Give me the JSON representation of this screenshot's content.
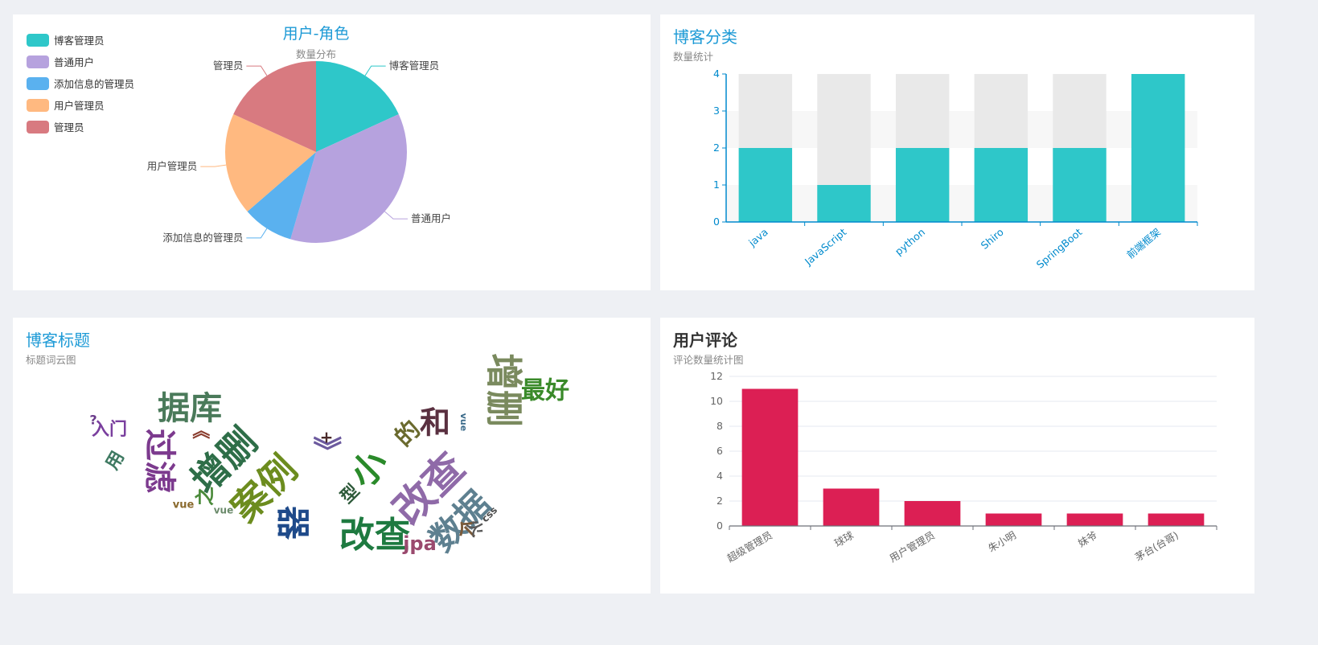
{
  "pie_panel": {
    "title": "用户-角色",
    "subtitle": "数量分布",
    "chart_data": {
      "type": "pie",
      "title": "用户-角色",
      "subtitle": "数量分布",
      "legend_position": "top-left",
      "slices": [
        {
          "label": "博客管理员",
          "value": 2,
          "color": "#2ec7c9"
        },
        {
          "label": "普通用户",
          "value": 4,
          "color": "#b6a2de"
        },
        {
          "label": "添加信息的管理员",
          "value": 1,
          "color": "#5ab1ef"
        },
        {
          "label": "用户管理员",
          "value": 2,
          "color": "#ffb980"
        },
        {
          "label": "管理员",
          "value": 2,
          "color": "#d87a80"
        }
      ]
    }
  },
  "category_panel": {
    "title": "博客分类",
    "subtitle": "数量统计",
    "chart_data": {
      "type": "bar",
      "title": "博客分类",
      "subtitle": "数量统计",
      "categories": [
        "java",
        "JavaScript",
        "python",
        "Shiro",
        "SpringBoot",
        "前端框架"
      ],
      "values": [
        2,
        1,
        2,
        2,
        2,
        4
      ],
      "background_values": [
        4,
        4,
        4,
        4,
        4,
        4
      ],
      "ylim": [
        0,
        4
      ],
      "yticks": [
        "0",
        "1",
        "2",
        "3",
        "4"
      ],
      "bar_color": "#2ec7c9",
      "background_color": "#e9e9e9",
      "axis_color": "#008acd"
    }
  },
  "wordcloud_panel": {
    "title": "博客标题",
    "subtitle": "标题词云图",
    "words": [
      {
        "text": "据库",
        "color": "#4a7a5a"
      },
      {
        "text": "增删",
        "color": "#2e6e48"
      },
      {
        "text": "过滤",
        "color": "#7c3a8e"
      },
      {
        "text": "案例",
        "color": "#6c8c1e"
      },
      {
        "text": "入门",
        "color": "#7a3f9e"
      },
      {
        "text": "用",
        "color": "#3f7a62"
      },
      {
        "text": "《",
        "color": "#8a3d2e"
      },
      {
        "text": "》",
        "color": "#6c5a9e"
      },
      {
        "text": "小",
        "color": "#2a8a2a"
      },
      {
        "text": "改查",
        "color": "#8f6aa8"
      },
      {
        "text": "数据",
        "color": "#5e8090"
      },
      {
        "text": "和",
        "color": "#5a3040"
      },
      {
        "text": "增删",
        "color": "#7a8a5e"
      },
      {
        "text": "最好",
        "color": "#3a8a2a"
      },
      {
        "text": "改查",
        "color": "#1e7a40"
      },
      {
        "text": "器",
        "color": "#1e4a8a"
      },
      {
        "text": "jpa",
        "color": "#9a4a6e"
      },
      {
        "text": "vue",
        "color": "#8a6a2e"
      },
      {
        "text": "vue",
        "color": "#6a8a6a"
      },
      {
        "text": "css",
        "color": "#4a4a4a"
      },
      {
        "text": "vue",
        "color": "#3a6a8a"
      },
      {
        "text": "的",
        "color": "#6a6a2e"
      },
      {
        "text": "个",
        "color": "#7a5a3a"
      },
      {
        "text": "型",
        "color": "#2e5a3a"
      },
      {
        "text": "之",
        "color": "#4a8a3a"
      },
      {
        "text": "火",
        "color": "#5a5a5a"
      },
      {
        "text": "+",
        "color": "#4a2a2a"
      },
      {
        "text": "?",
        "color": "#6a3a8a"
      }
    ]
  },
  "comment_panel": {
    "title": "用户评论",
    "subtitle": "评论数量统计图",
    "chart_data": {
      "type": "bar",
      "title": "用户评论",
      "subtitle": "评论数量统计图",
      "categories": [
        "超级管理员",
        "球球",
        "用户管理员",
        "朱小明",
        "妹爷",
        "茅台(台哥)"
      ],
      "values": [
        11,
        3,
        2,
        1,
        1,
        1
      ],
      "ylim": [
        0,
        12
      ],
      "yticks": [
        "0",
        "2",
        "4",
        "6",
        "8",
        "10",
        "12"
      ],
      "bar_color": "#dc1f54",
      "grid": true
    }
  }
}
